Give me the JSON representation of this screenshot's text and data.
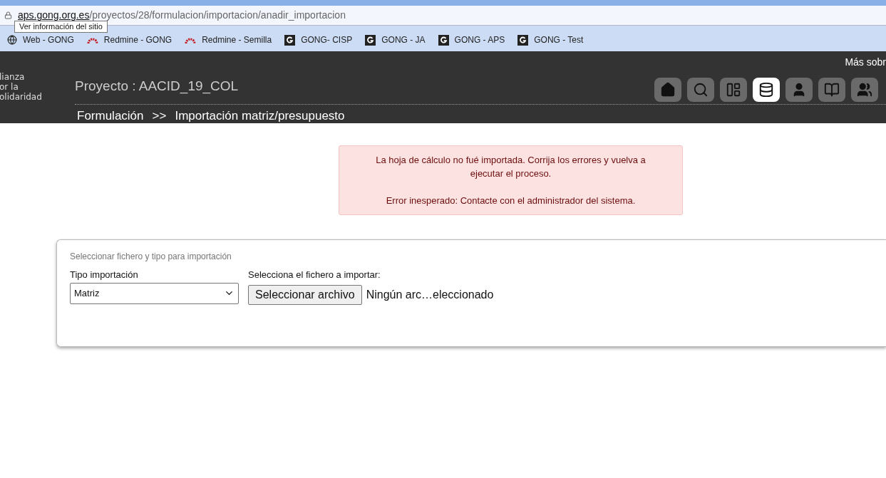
{
  "browser": {
    "url_host": "aps.gong.org.es",
    "url_path": "/proyectos/28/formulacion/importacion/anadir_importacion",
    "tooltip": "Ver información del sitio",
    "bookmarks": [
      {
        "kind": "globe",
        "label": "Web - GONG"
      },
      {
        "kind": "redmine",
        "label": "Redmine - GONG"
      },
      {
        "kind": "redmine",
        "label": "Redmine - Semilla"
      },
      {
        "kind": "gong",
        "label": "GONG- CISP"
      },
      {
        "kind": "gong",
        "label": "GONG - JA"
      },
      {
        "kind": "gong",
        "label": "GONG - APS"
      },
      {
        "kind": "gong",
        "label": "GONG - Test"
      }
    ]
  },
  "header": {
    "logo_lines": [
      "lianza",
      "or la",
      "olidaridad"
    ],
    "project_title": "Proyecto : AACID_19_COL",
    "top_link": "Más sobr",
    "nav_icons": [
      {
        "kind": "home",
        "selected": false
      },
      {
        "kind": "search",
        "selected": false
      },
      {
        "kind": "layout",
        "selected": false
      },
      {
        "kind": "database",
        "selected": true
      },
      {
        "kind": "user",
        "selected": false
      },
      {
        "kind": "book",
        "selected": false
      },
      {
        "kind": "users",
        "selected": false
      }
    ],
    "breadcrumb": {
      "section": "Formulación",
      "separator": ">>",
      "current": "Importación matriz/presupuesto"
    }
  },
  "alert": {
    "paragraphs": [
      "La hoja de cálculo no fué importada. Corrija los errores y vuelva a ejecutar el proceso.",
      "Error inesperado: Contacte con el administrador del sistema."
    ]
  },
  "form": {
    "legend": "Seleccionar fichero y tipo para importación",
    "type_label": "Tipo importación",
    "type_value": "Matriz",
    "file_label": "Selecciona el fichero a importar:",
    "file_button": "Seleccionar archivo",
    "file_status": "Ningún arc…eleccionado"
  }
}
